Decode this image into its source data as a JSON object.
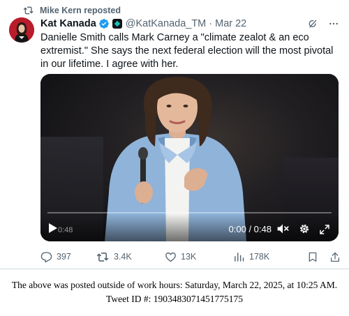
{
  "repost": {
    "text": "Mike Kern reposted"
  },
  "tweet": {
    "author_name": "Kat Kanada",
    "handle": "@KatKanada_TM",
    "separator": "·",
    "date": "Mar 22",
    "text": "Danielle Smith calls Mark Carney a \"climate zealot & an eco extremist.\" She says the next federal election will the most pivotal in our lifetime. I agree with her."
  },
  "video": {
    "thumb_time": "0:48",
    "time_display": "0:00 / 0:48",
    "progress": 0
  },
  "actions": {
    "replies": "397",
    "reposts": "3.4K",
    "likes": "13K",
    "views": "178K"
  },
  "footer": {
    "line1": "The above was posted outside of work hours: Saturday, March 22, 2025, at 10:25 AM.",
    "line2": "Tweet ID #: 1903483071451775175"
  },
  "colors": {
    "secondary_text": "#536471",
    "verified_blue": "#1d9bf0",
    "avatar_red": "#b91c2a",
    "divider": "#cfd9de"
  },
  "icons": [
    "repost-icon",
    "verified-badge-icon",
    "affiliate-badge-icon",
    "grok-icon",
    "more-icon",
    "play-icon",
    "volume-muted-icon",
    "settings-icon",
    "fullscreen-icon",
    "reply-icon",
    "retweet-icon",
    "like-icon",
    "views-icon",
    "bookmark-icon",
    "share-icon"
  ]
}
